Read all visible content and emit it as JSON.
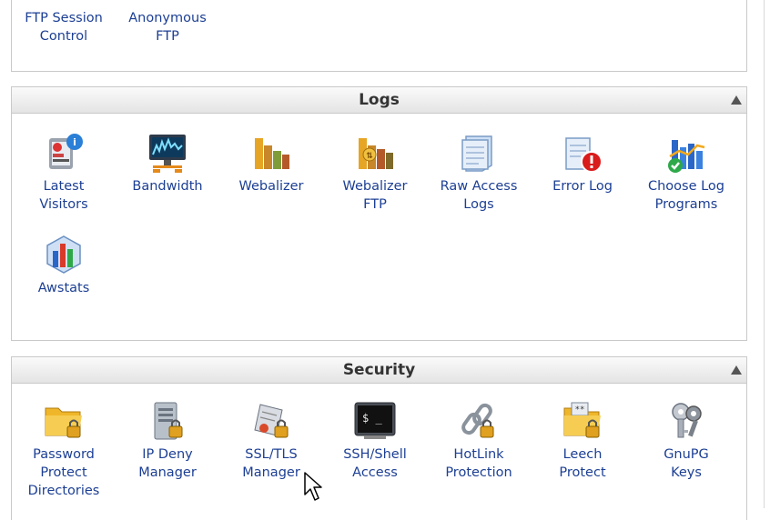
{
  "ftp_panel": {
    "items": [
      {
        "label": "FTP Session\nControl"
      },
      {
        "label": "Anonymous\nFTP"
      }
    ]
  },
  "logs_panel": {
    "title": "Logs",
    "items": [
      {
        "label": "Latest\nVisitors",
        "icon": "latest-visitors-icon"
      },
      {
        "label": "Bandwidth",
        "icon": "bandwidth-icon"
      },
      {
        "label": "Webalizer",
        "icon": "webalizer-icon"
      },
      {
        "label": "Webalizer\nFTP",
        "icon": "webalizer-ftp-icon"
      },
      {
        "label": "Raw Access\nLogs",
        "icon": "raw-access-logs-icon"
      },
      {
        "label": "Error Log",
        "icon": "error-log-icon"
      },
      {
        "label": "Choose Log\nPrograms",
        "icon": "choose-log-programs-icon"
      },
      {
        "label": "Awstats",
        "icon": "awstats-icon"
      }
    ]
  },
  "security_panel": {
    "title": "Security",
    "items": [
      {
        "label": "Password\nProtect\nDirectories",
        "icon": "password-folder-icon"
      },
      {
        "label": "IP Deny\nManager",
        "icon": "ip-deny-server-icon"
      },
      {
        "label": "SSL/TLS\nManager",
        "icon": "ssl-certificate-icon"
      },
      {
        "label": "SSH/Shell\nAccess",
        "icon": "terminal-icon"
      },
      {
        "label": "HotLink\nProtection",
        "icon": "chain-lock-icon"
      },
      {
        "label": "Leech\nProtect",
        "icon": "leech-folder-icon"
      },
      {
        "label": "GnuPG\nKeys",
        "icon": "keys-icon"
      }
    ]
  },
  "colors": {
    "link": "#1c3f94",
    "header_text": "#333333",
    "border": "#c9c9c9"
  }
}
